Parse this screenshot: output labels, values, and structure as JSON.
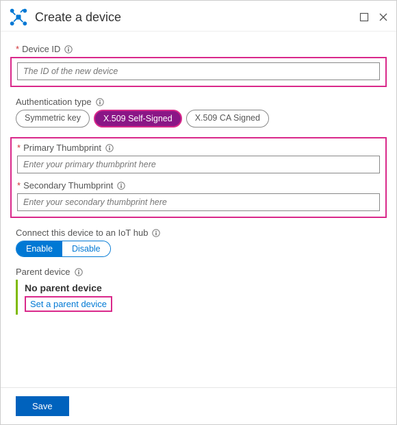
{
  "header": {
    "title": "Create a device"
  },
  "device_id": {
    "label": "Device ID",
    "placeholder": "The ID of the new device",
    "value": ""
  },
  "auth_type": {
    "label": "Authentication type",
    "options": [
      "Symmetric key",
      "X.509 Self-Signed",
      "X.509 CA Signed"
    ],
    "selected_index": 1
  },
  "primary_thumbprint": {
    "label": "Primary Thumbprint",
    "placeholder": "Enter your primary thumbprint here",
    "value": ""
  },
  "secondary_thumbprint": {
    "label": "Secondary Thumbprint",
    "placeholder": "Enter your secondary thumbprint here",
    "value": ""
  },
  "connect_hub": {
    "label": "Connect this device to an IoT hub",
    "options": [
      "Enable",
      "Disable"
    ],
    "selected_index": 0
  },
  "parent_device": {
    "label": "Parent device",
    "none_text": "No parent device",
    "link_text": "Set a parent device"
  },
  "footer": {
    "save_label": "Save"
  },
  "colors": {
    "primary_blue": "#0078d4",
    "accent_purple": "#8a1686",
    "highlight_pink": "#d9288a",
    "required_red": "#d13438"
  }
}
